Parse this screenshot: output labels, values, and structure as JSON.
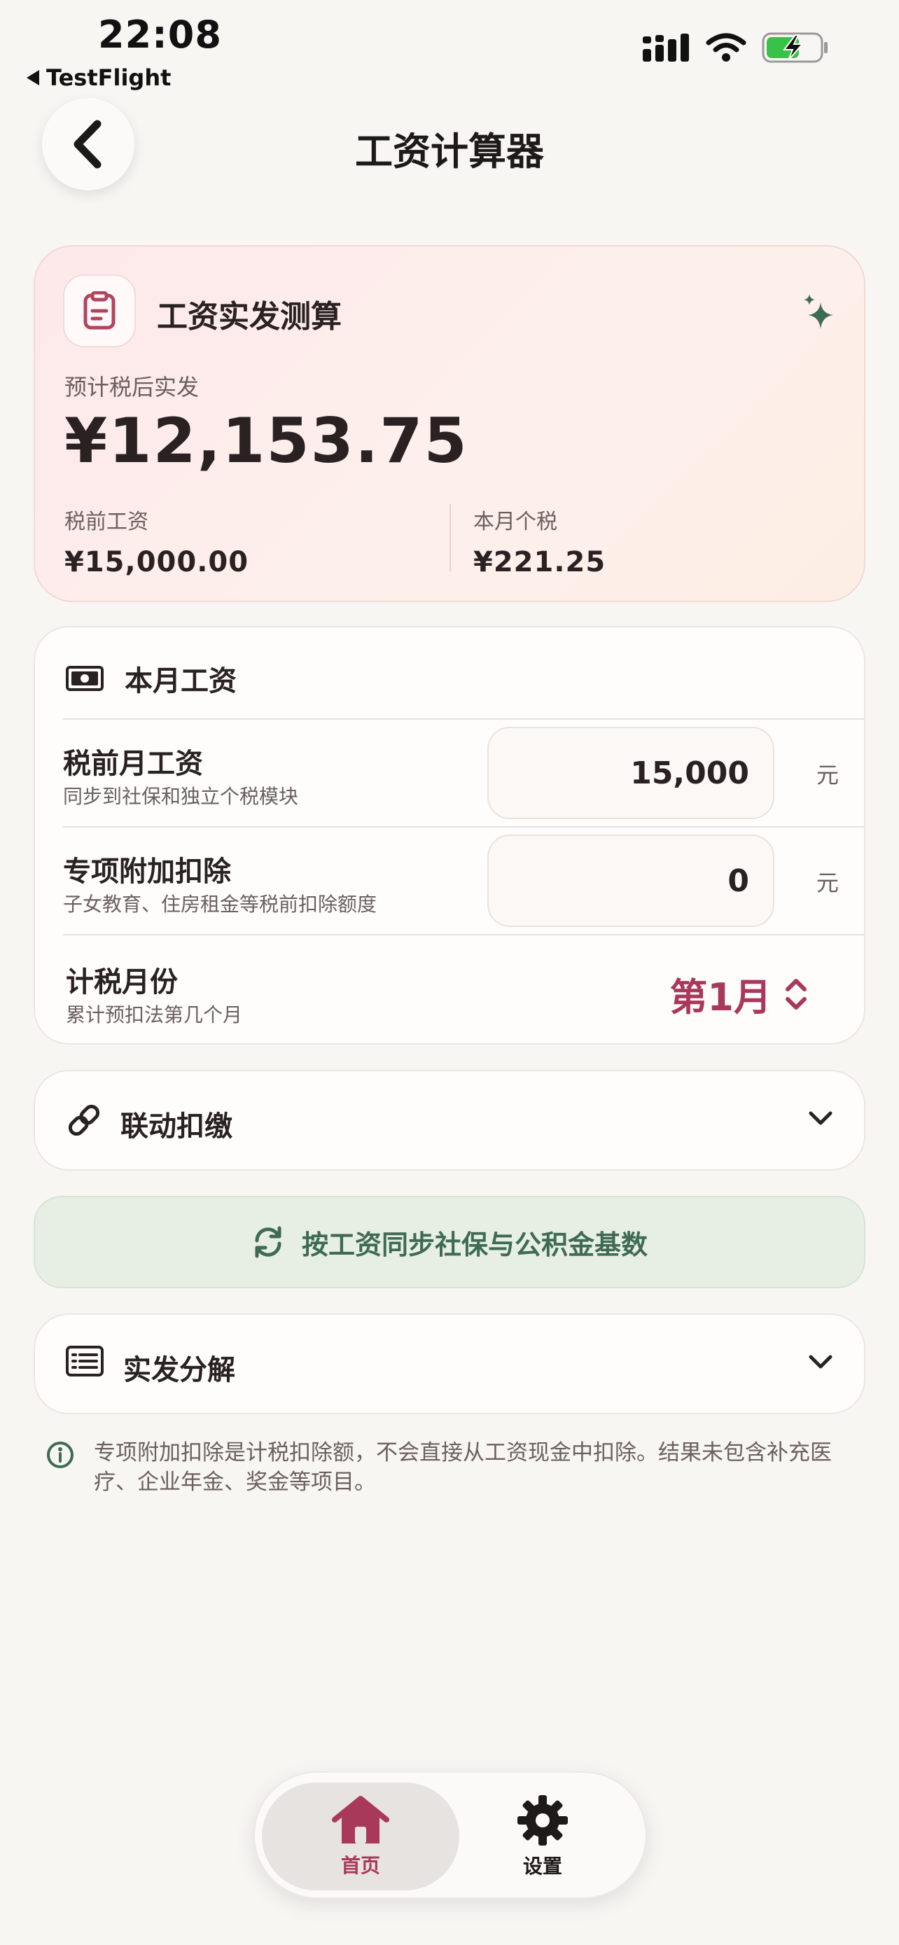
{
  "status_bar": {
    "time": "22:08",
    "back_app": "TestFlight"
  },
  "header": {
    "title": "工资计算器"
  },
  "summary": {
    "title": "工资实发测算",
    "net_label": "预计税后实发",
    "net_amount": "¥12,153.75",
    "gross_label": "税前工资",
    "gross_value": "¥15,000.00",
    "tax_label": "本月个税",
    "tax_value": "¥221.25"
  },
  "salary": {
    "title": "本月工资",
    "gross": {
      "title": "税前月工资",
      "subtitle": "同步到社保和独立个税模块",
      "value": "15,000",
      "unit": "元"
    },
    "deduction": {
      "title": "专项附加扣除",
      "subtitle": "子女教育、住房租金等税前扣除额度",
      "value": "0",
      "unit": "元"
    },
    "month": {
      "title": "计税月份",
      "subtitle": "累计预扣法第几个月",
      "value": "第1月"
    }
  },
  "linked": {
    "title": "联动扣缴"
  },
  "sync": {
    "label": "按工资同步社保与公积金基数"
  },
  "breakdown": {
    "title": "实发分解"
  },
  "note": {
    "text": "专项附加扣除是计税扣除额，不会直接从工资现金中扣除。结果未包含补充医疗、企业年金、奖金等项目。"
  },
  "tabs": {
    "home": "首页",
    "settings": "设置"
  },
  "colors": {
    "accent": "#a8395a",
    "green": "#3f6b52",
    "background": "#f8f6f3"
  }
}
